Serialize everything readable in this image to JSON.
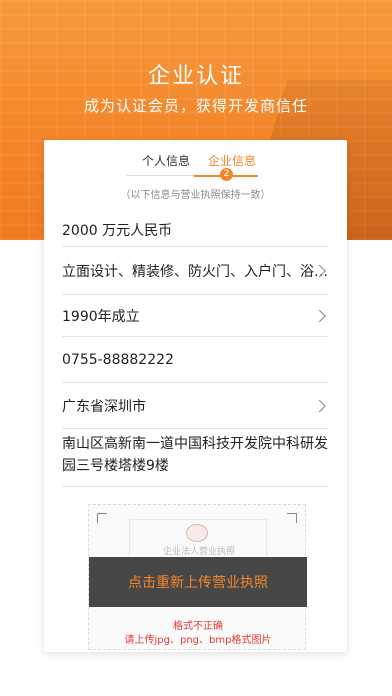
{
  "header": {
    "title": "企业认证",
    "subtitle": "成为认证会员，获得开发商信任"
  },
  "tabs": {
    "personal": "个人信息",
    "company": "企业信息",
    "step": "2"
  },
  "hint": "（以下信息与营业执照保持一致）",
  "fields": {
    "capital": "2000 万元人民币",
    "business_scope": "立面设计、精装修、防火门、入户门、浴…",
    "founded": "1990年成立",
    "phone": "0755-88882222",
    "location": "广东省深圳市",
    "address": "南山区高新南一道中国科技开发院中科研发园三号楼塔楼9楼"
  },
  "upload": {
    "preview_title": "企业法人营业执照",
    "button": "点击重新上传营业执照",
    "error_title": "格式不正确",
    "error_detail": "请上传jpg、png、bmp格式图片"
  },
  "colors": {
    "accent": "#f4862a",
    "error": "#e53935"
  }
}
